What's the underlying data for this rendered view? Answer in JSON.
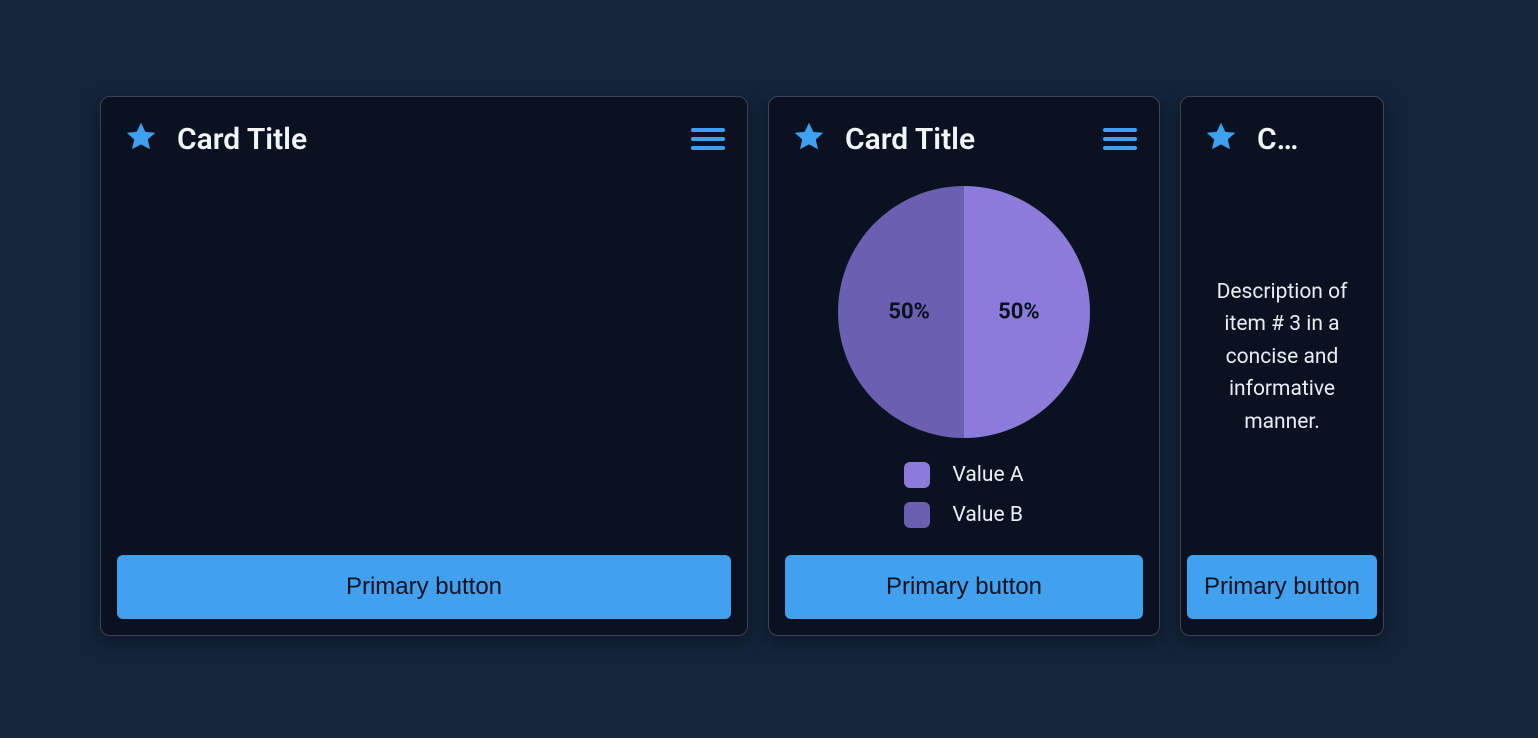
{
  "colors": {
    "accent": "#42a1ef",
    "star": "#3ea1ef",
    "pie_a": "#8c7bda",
    "pie_b": "#6a5fb0"
  },
  "cards": [
    {
      "title": "Card Title",
      "button_label": "Primary button"
    },
    {
      "title": "Card Title",
      "button_label": "Primary button",
      "pie": {
        "left_label": "50%",
        "right_label": "50%",
        "legend": [
          {
            "label": "Value A",
            "color": "#8c7bda"
          },
          {
            "label": "Value B",
            "color": "#6a5fb0"
          }
        ]
      }
    },
    {
      "title": "C…",
      "description": "Description of item # 3 in a concise and informative manner.",
      "button_label": "Primary button"
    }
  ],
  "chart_data": {
    "type": "pie",
    "title": "",
    "series": [
      {
        "name": "Value A",
        "value": 50,
        "color": "#8c7bda"
      },
      {
        "name": "Value B",
        "value": 50,
        "color": "#6a5fb0"
      }
    ]
  }
}
